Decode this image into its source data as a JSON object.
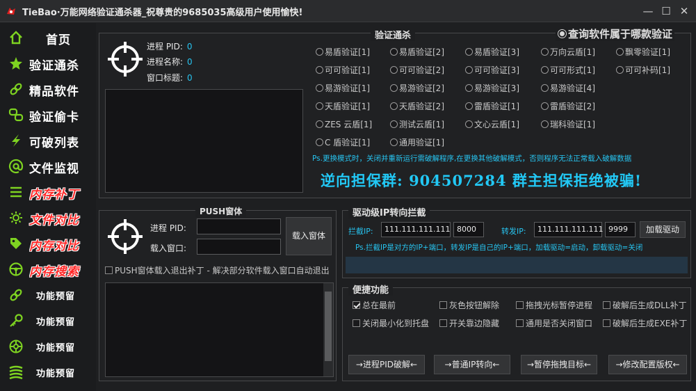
{
  "window": {
    "title": "TieBao·万能网络验证通杀器_祝尊贵的9685035高级用户使用愉快!",
    "min_icon": "minimize-icon",
    "max_icon": "maximize-icon",
    "close_icon": "close-icon"
  },
  "sidebar": {
    "items": [
      {
        "label": "首页",
        "icon": "home-icon",
        "style": "white"
      },
      {
        "label": "验证通杀",
        "icon": "star-icon",
        "style": "white"
      },
      {
        "label": "精品软件",
        "icon": "link-icon",
        "style": "white"
      },
      {
        "label": "验证偷卡",
        "icon": "chain-icon",
        "style": "white"
      },
      {
        "label": "可破列表",
        "icon": "lightning-icon",
        "style": "white"
      },
      {
        "label": "文件监视",
        "icon": "at-icon",
        "style": "white"
      },
      {
        "label": "内存补丁",
        "icon": "list-icon",
        "style": "red"
      },
      {
        "label": "文件对比",
        "icon": "sun-icon",
        "style": "red"
      },
      {
        "label": "内存对比",
        "icon": "tag-icon",
        "style": "red"
      },
      {
        "label": "内存搜索",
        "icon": "wheel-icon",
        "style": "red"
      },
      {
        "label": "功能预留",
        "icon": "link2-icon",
        "style": "small"
      },
      {
        "label": "功能预留",
        "icon": "key-icon",
        "style": "small"
      },
      {
        "label": "功能预留",
        "icon": "target-icon",
        "style": "small"
      },
      {
        "label": "功能预留",
        "icon": "stack-icon",
        "style": "small"
      }
    ],
    "accent": "#7ed321"
  },
  "process_panel": {
    "pid_label": "进程 PID:",
    "pid_value": "0",
    "name_label": "进程名称:",
    "name_value": "0",
    "window_title_label": "窗口标题:",
    "window_title_value": "0"
  },
  "verify_panel": {
    "title": "验证通杀",
    "query_option": "查询软件属于哪款验证",
    "options": [
      [
        "易盾验证[1]",
        "易盾验证[2]",
        "易盾验证[3]",
        "万向云盾[1]",
        "飘零验证[1]"
      ],
      [
        "可可验证[1]",
        "可可验证[2]",
        "可可验证[3]",
        "可可形式[1]",
        "可可补码[1]"
      ],
      [
        "易游验证[1]",
        "易游验证[2]",
        "易游验证[3]",
        "易游验证[4]"
      ],
      [
        "天盾验证[1]",
        "天盾验证[2]",
        "雷盾验证[1]",
        "雷盾验证[2]"
      ],
      [
        "ZES 云盾[1]",
        "测试云盾[1]",
        "文心云盾[1]",
        "瑞科验证[1]"
      ],
      [
        "C 盾验证[1]",
        "通用验证[1]"
      ]
    ],
    "note": "Ps.更换模式时，关闭并重新运行需破解程序,在更换其他破解模式，否则程序无法正常载入破解数据",
    "guarantee": "逆向担保群: 904507284  群主担保拒绝被骗!"
  },
  "push_panel": {
    "title": "PUSH窗体",
    "pid_label": "进程 PID:",
    "window_label": "载入窗口:",
    "load_button": "载入窗体",
    "patch_checkbox": "PUSH窗体载入退出补丁 - 解决部分软件载入窗口自动退出"
  },
  "ip_panel": {
    "title": "驱动级IP转向拦截",
    "intercept_label": "拦截IP:",
    "intercept_ip": "111.111.111.111",
    "intercept_port": "8000",
    "forward_label": "转发IP:",
    "forward_ip": "111.111.111.111",
    "forward_port": "9999",
    "load_driver_button": "加载驱动",
    "note": "Ps.拦截IP是对方的IP+端口，转发IP是自己的IP+端口，加载驱动=启动，卸载驱动=关闭"
  },
  "quick_panel": {
    "title": "便捷功能",
    "checkboxes": [
      {
        "label": "总在最前",
        "checked": true
      },
      {
        "label": "灰色按钮解除",
        "checked": false
      },
      {
        "label": "拖拽光标暂停进程",
        "checked": false
      },
      {
        "label": "破解后生成DLL补丁",
        "checked": false
      },
      {
        "label": "关闭最小化到托盘",
        "checked": false
      },
      {
        "label": "开关靠边隐藏",
        "checked": false
      },
      {
        "label": "通用是否关闭窗口",
        "checked": false
      },
      {
        "label": "破解后生成EXE补丁",
        "checked": false
      }
    ],
    "buttons": [
      "→进程PID破解←",
      "→普通IP转向←",
      "→暂停拖拽目标←",
      "→修改配置版权←"
    ]
  }
}
